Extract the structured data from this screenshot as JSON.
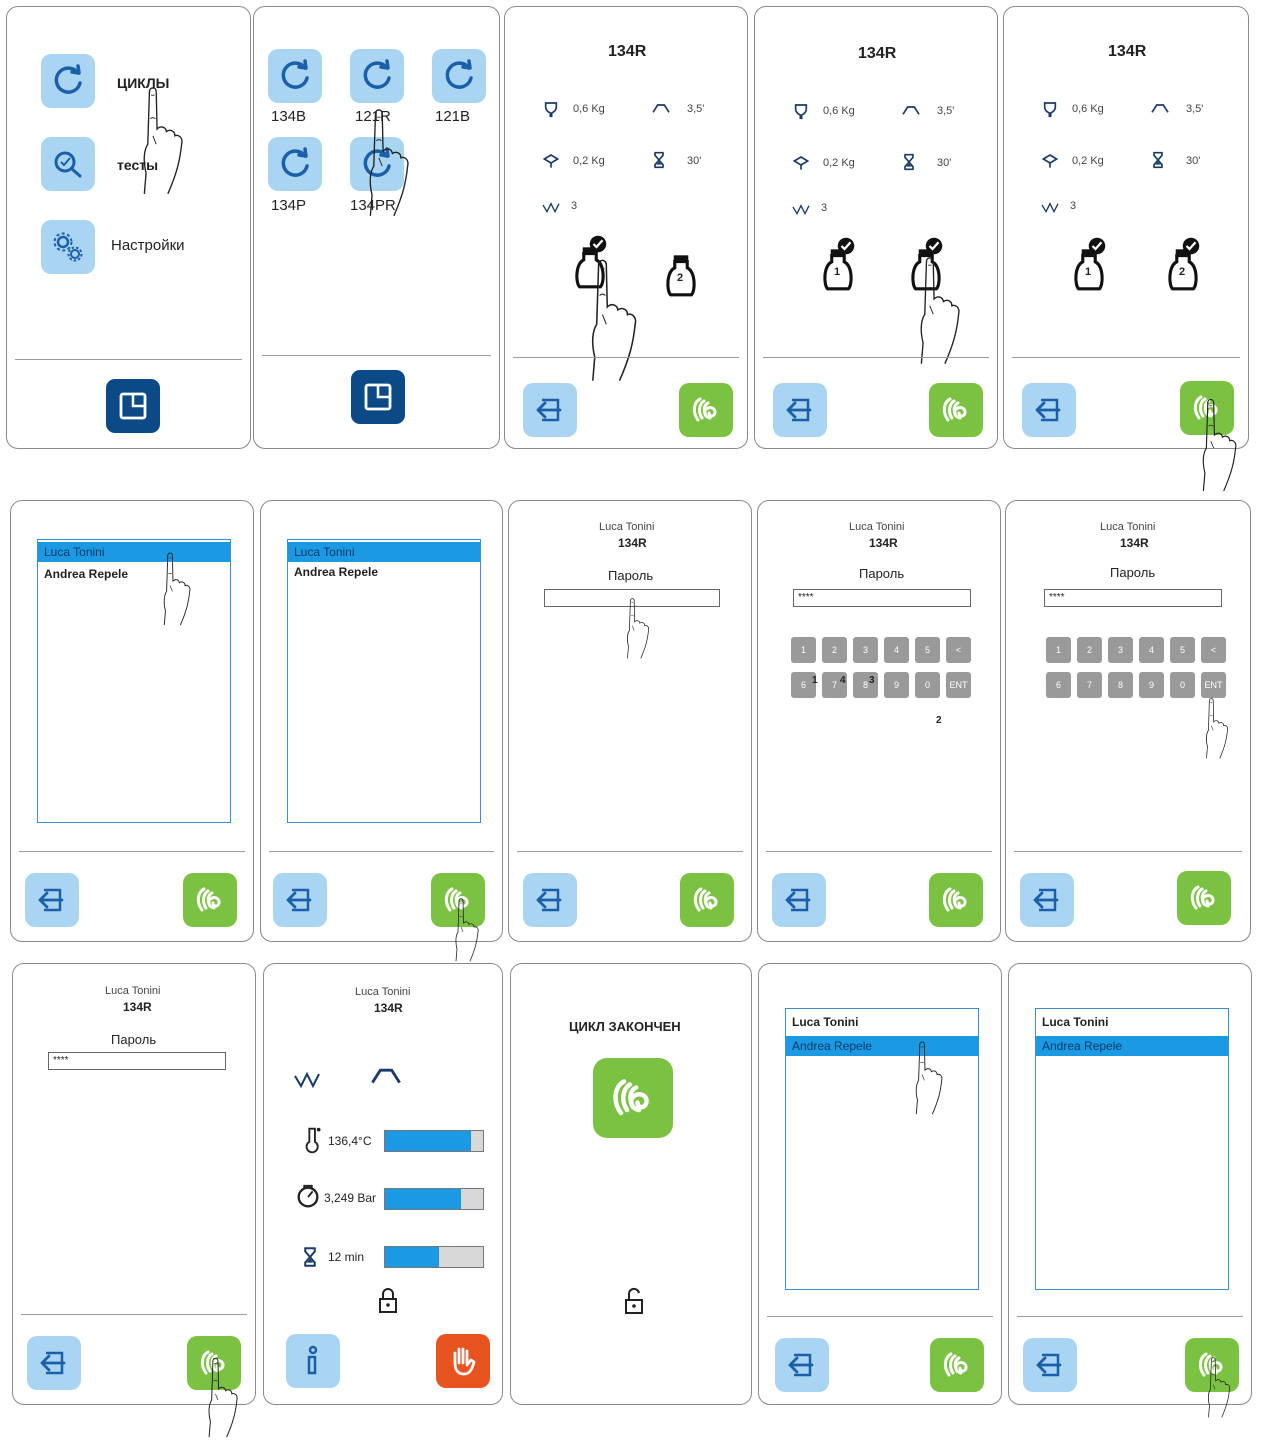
{
  "menu": {
    "cycles": "ЦИКЛЫ",
    "tests": "тесты",
    "settings": "Настройки"
  },
  "cycles_panel": {
    "items": [
      "134B",
      "121R",
      "121B",
      "134P",
      "134PR"
    ]
  },
  "cycle_title": "134R",
  "params": {
    "weight1": "0,6 Kg",
    "weight2": "0,2 Kg",
    "w_value": "3",
    "temp_ramp": "3,5'",
    "time": "30'"
  },
  "bottle_labels": [
    "1",
    "2"
  ],
  "users": {
    "user1": "Luca Tonini",
    "user2": "Andrea Repele"
  },
  "login": {
    "password_label": "Пароль",
    "masked": "****"
  },
  "keypad": {
    "row1": [
      "1",
      "2",
      "3",
      "4",
      "5",
      "<"
    ],
    "row2": [
      "6",
      "7",
      "8",
      "9",
      "0",
      "ENT"
    ],
    "press_seq": [
      "1",
      "4",
      "3",
      "2"
    ]
  },
  "running": {
    "temperature": "136,4°C",
    "pressure": "3,249 Bar",
    "time_left": "12 min",
    "temperature_level": 0.88,
    "pressure_level": 0.78,
    "time_level": 0.55
  },
  "done": {
    "message": "ЦИКЛ ЗАКОНЧЕН"
  }
}
